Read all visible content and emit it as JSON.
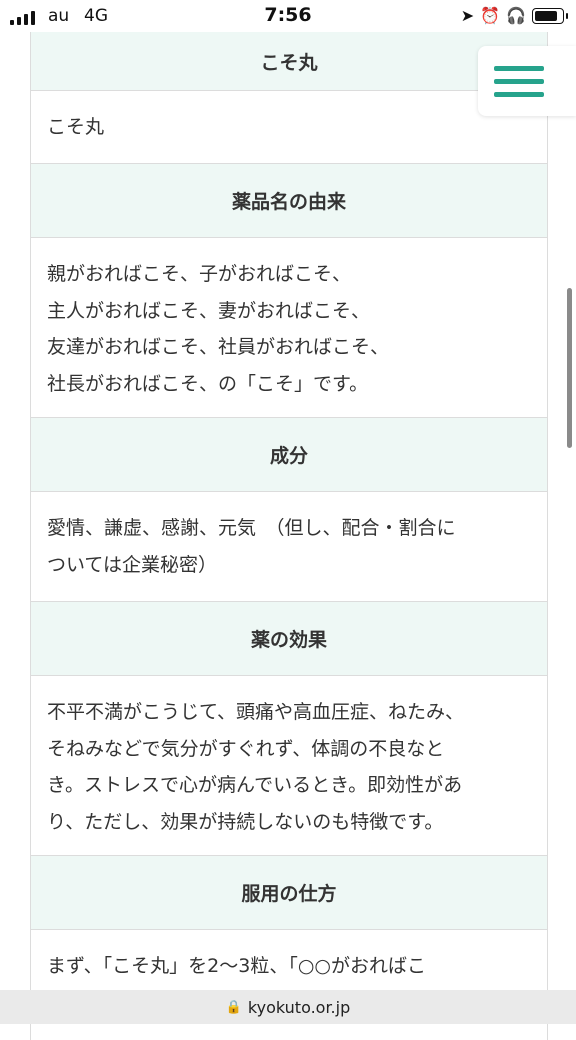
{
  "status_bar": {
    "carrier": "au",
    "network": "4G",
    "time": "7:56"
  },
  "table": {
    "rows": [
      {
        "header": "こそ丸",
        "content": [
          "こそ丸"
        ]
      },
      {
        "header": "薬品名の由来",
        "content": [
          "親がおればこそ、子がおればこそ、",
          "主人がおればこそ、妻がおればこそ、",
          "友達がおればこそ、社員がおればこそ、",
          "社長がおればこそ、の「こそ」です。"
        ]
      },
      {
        "header": "成分",
        "content": [
          "愛情、謙虚、感謝、元気　（但し、配合・割合に",
          "ついては企業秘密）"
        ]
      },
      {
        "header": "薬の効果",
        "content": [
          "不平不満がこうじて、頭痛や高血圧症、ねたみ、",
          "そねみなどで気分がすぐれず、体調の不良なと",
          "き。ストレスで心が病んでいるとき。即効性があ",
          "り、ただし、効果が持続しないのも特徴です。"
        ]
      },
      {
        "header": "服用の仕方",
        "content": [
          "まず、「こそ丸」を2〜3粒、「○○がおればこ"
        ]
      }
    ]
  },
  "url_bar": {
    "domain": "kyokuto.or.jp"
  },
  "icons": {
    "menu": "hamburger-menu-icon",
    "lock": "lock-icon"
  },
  "colors": {
    "accent": "#26a38c",
    "header_bg": "#eef8f5"
  }
}
